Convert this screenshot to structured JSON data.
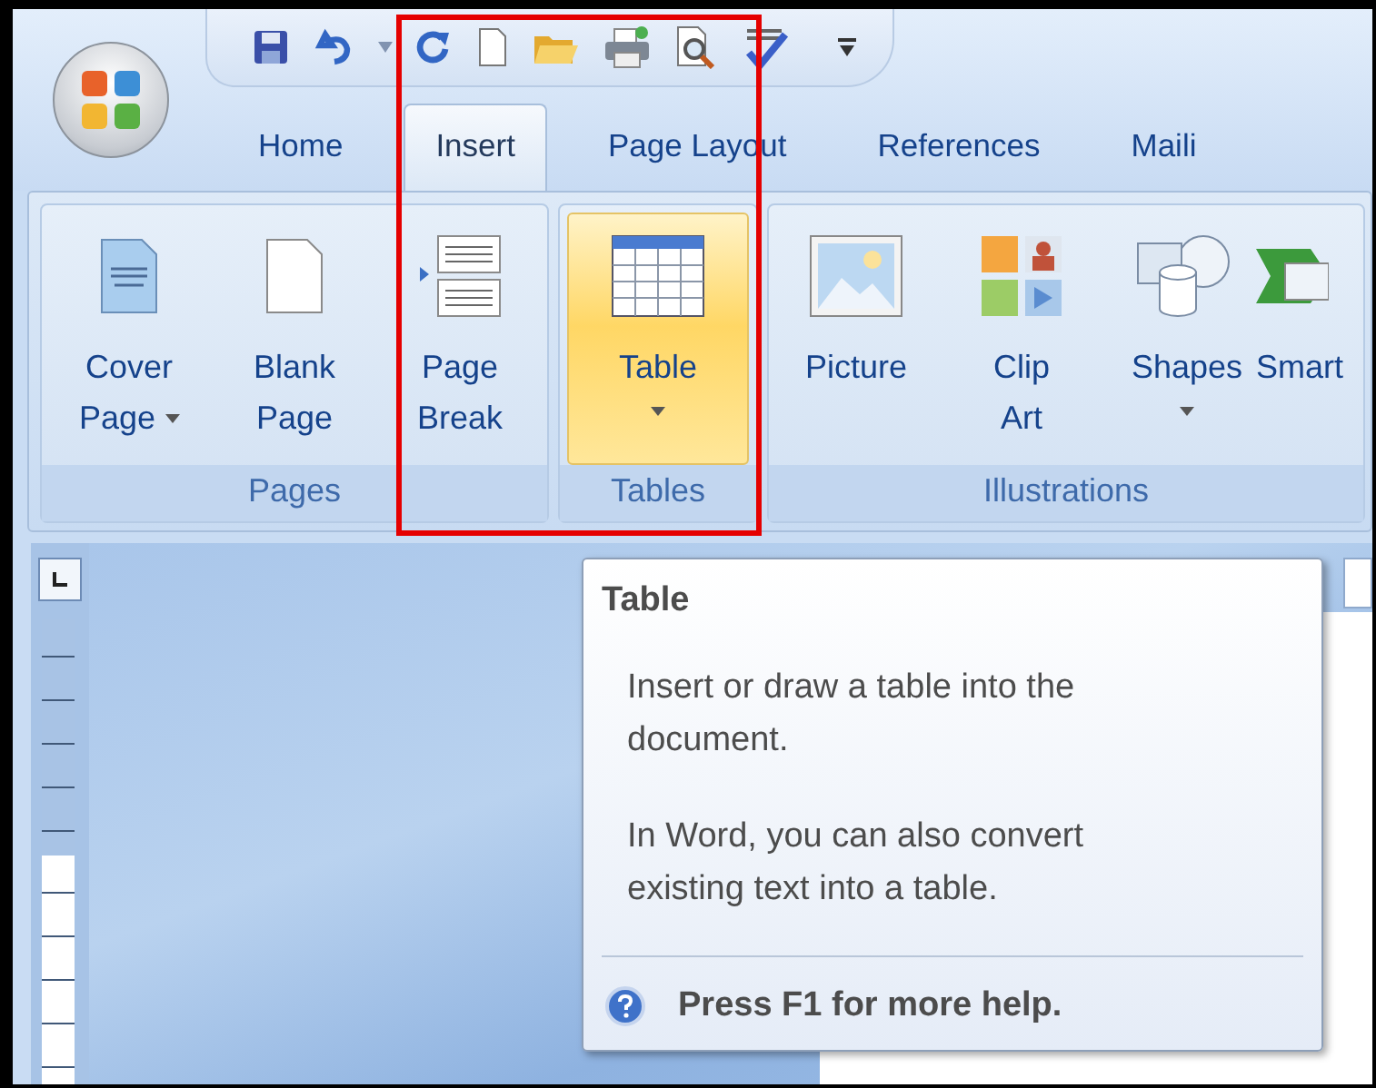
{
  "tabs": [
    {
      "label": "Home",
      "selected": false
    },
    {
      "label": "Insert",
      "selected": true
    },
    {
      "label": "Page Layout",
      "selected": false
    },
    {
      "label": "References",
      "selected": false
    },
    {
      "label": "Maili",
      "selected": false
    }
  ],
  "ribbon": {
    "groups": [
      {
        "label": "Pages",
        "buttons": [
          {
            "kind": "cover-page",
            "lines": [
              "Cover",
              "Page"
            ],
            "dropdown": true,
            "hovered": false
          },
          {
            "kind": "blank-page",
            "lines": [
              "Blank",
              "Page"
            ],
            "dropdown": false,
            "hovered": false
          },
          {
            "kind": "page-break",
            "lines": [
              "Page",
              "Break"
            ],
            "dropdown": false,
            "hovered": false
          }
        ]
      },
      {
        "label": "Tables",
        "buttons": [
          {
            "kind": "table",
            "lines": [
              "Table"
            ],
            "dropdown": true,
            "hovered": true
          }
        ]
      },
      {
        "label": "Illustrations",
        "buttons": [
          {
            "kind": "picture",
            "lines": [
              "Picture"
            ],
            "dropdown": false,
            "hovered": false
          },
          {
            "kind": "clip-art",
            "lines": [
              "Clip",
              "Art"
            ],
            "dropdown": false,
            "hovered": false
          },
          {
            "kind": "shapes",
            "lines": [
              "Shapes"
            ],
            "dropdown": true,
            "hovered": false
          },
          {
            "kind": "smartart",
            "lines": [
              "Smart"
            ],
            "dropdown": false,
            "hovered": false
          }
        ]
      }
    ]
  },
  "tooltip": {
    "title": "Table",
    "paragraphs": [
      "Insert or draw a table into the document.",
      "In Word, you can also convert existing text into a table."
    ],
    "help": "Press F1 for more help."
  }
}
